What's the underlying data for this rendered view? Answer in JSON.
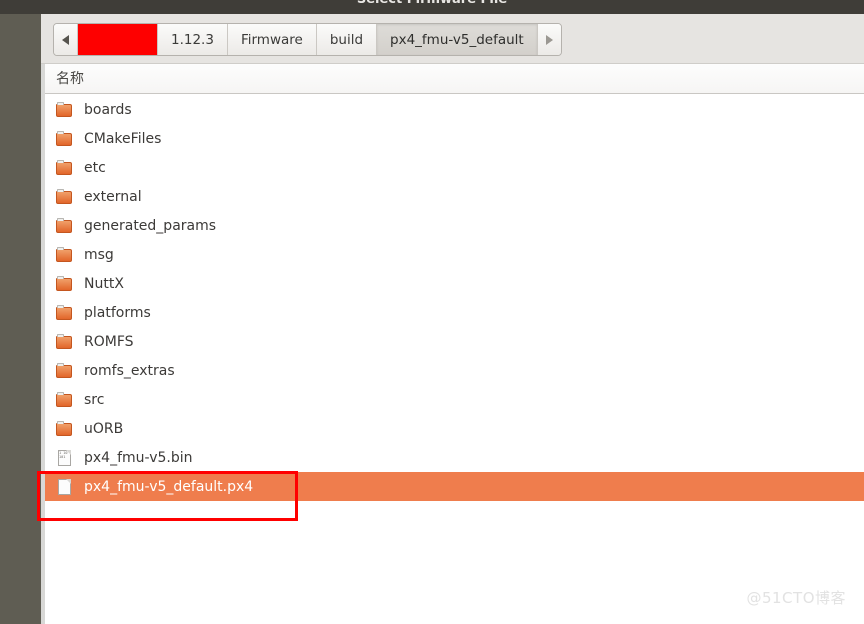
{
  "window": {
    "title": "Select Firmware File"
  },
  "pathbar": {
    "back_icon": "arrow-left-icon",
    "forward_icon": "arrow-right-icon",
    "crumbs": [
      {
        "label": "",
        "redacted": true,
        "active": false
      },
      {
        "label": "1.12.3",
        "redacted": false,
        "active": false
      },
      {
        "label": "Firmware",
        "redacted": false,
        "active": false
      },
      {
        "label": "build",
        "redacted": false,
        "active": false
      },
      {
        "label": "px4_fmu-v5_default",
        "redacted": false,
        "active": true
      }
    ]
  },
  "filelist": {
    "column_header": "名称",
    "items": [
      {
        "name": "boards",
        "type": "folder",
        "selected": false
      },
      {
        "name": "CMakeFiles",
        "type": "folder",
        "selected": false
      },
      {
        "name": "etc",
        "type": "folder",
        "selected": false
      },
      {
        "name": "external",
        "type": "folder",
        "selected": false
      },
      {
        "name": "generated_params",
        "type": "folder",
        "selected": false
      },
      {
        "name": "msg",
        "type": "folder",
        "selected": false
      },
      {
        "name": "NuttX",
        "type": "folder",
        "selected": false
      },
      {
        "name": "platforms",
        "type": "folder",
        "selected": false
      },
      {
        "name": "ROMFS",
        "type": "folder",
        "selected": false
      },
      {
        "name": "romfs_extras",
        "type": "folder",
        "selected": false
      },
      {
        "name": "src",
        "type": "folder",
        "selected": false
      },
      {
        "name": "uORB",
        "type": "folder",
        "selected": false
      },
      {
        "name": "px4_fmu-v5.bin",
        "type": "binary-file",
        "selected": false
      },
      {
        "name": "px4_fmu-v5_default.px4",
        "type": "file",
        "selected": true
      }
    ]
  },
  "annotation": {
    "shape": "rectangle",
    "color": "#ff0000",
    "target": "px4_fmu-v5_default.px4"
  },
  "watermark": {
    "text": "@51CTO博客"
  },
  "colors": {
    "selection": "#ef7d4d",
    "titlebar": "#3f3d38",
    "gutter": "#5f5d53",
    "pathbar": "#e6e4e1",
    "redaction": "#fe0000",
    "annotation": "#ff0000"
  }
}
